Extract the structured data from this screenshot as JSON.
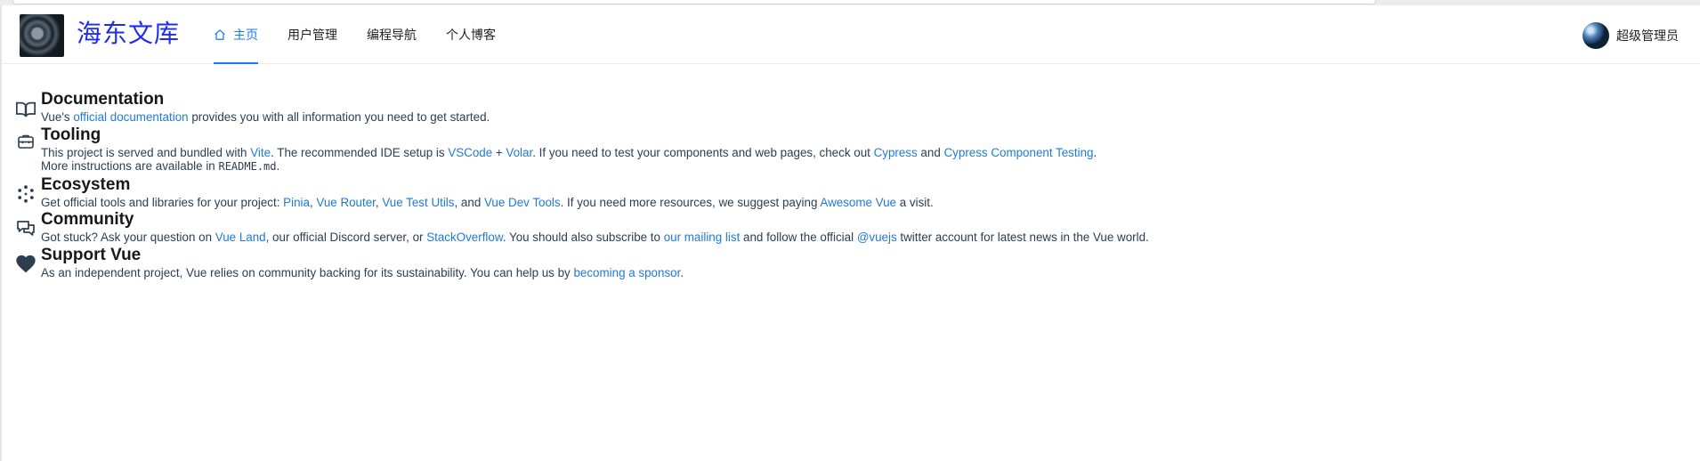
{
  "header": {
    "site_title": "海东文库",
    "nav": [
      {
        "label": "主页",
        "icon": "home-icon",
        "active": true
      },
      {
        "label": "用户管理"
      },
      {
        "label": "编程导航"
      },
      {
        "label": "个人博客"
      }
    ],
    "user_name": "超级管理员"
  },
  "sections": {
    "documentation": {
      "title": "Documentation",
      "icon": "book-icon",
      "t1": "Vue's ",
      "l1": "official documentation",
      "t2": " provides you with all information you need to get started."
    },
    "tooling": {
      "title": "Tooling",
      "icon": "toolbox-icon",
      "t1": "This project is served and bundled with ",
      "l_vite": "Vite",
      "t2": ". The recommended IDE setup is ",
      "l_vscode": "VSCode",
      "t3": " + ",
      "l_volar": "Volar",
      "t4": ". If you need to test your components and web pages, check out ",
      "l_cypress": "Cypress",
      "t5": " and ",
      "l_cypress_ct": "Cypress Component Testing",
      "t6": ".",
      "t7": "More instructions are available in ",
      "code": "README.md",
      "t8": "."
    },
    "ecosystem": {
      "title": "Ecosystem",
      "icon": "ecosystem-icon",
      "t1": "Get official tools and libraries for your project: ",
      "l_pinia": "Pinia",
      "t2": ", ",
      "l_router": "Vue Router",
      "t3": ", ",
      "l_test_utils": "Vue Test Utils",
      "t4": ", and ",
      "l_devtools": "Vue Dev Tools",
      "t5": ". If you need more resources, we suggest paying ",
      "l_awesome": "Awesome Vue",
      "t6": " a visit."
    },
    "community": {
      "title": "Community",
      "icon": "chat-bubbles-icon",
      "t1": "Got stuck? Ask your question on ",
      "l_vueland": "Vue Land",
      "t2": ", our official Discord server, or ",
      "l_stackoverflow": "StackOverflow",
      "t3": ". You should also subscribe to ",
      "l_mailing": "our mailing list",
      "t4": " and follow the official ",
      "l_vuejs": "@vuejs",
      "t5": " twitter account for latest news in the Vue world."
    },
    "support": {
      "title": "Support Vue",
      "icon": "heart-icon",
      "t1": "As an independent project, Vue relies on community backing for its sustainability. You can help us by ",
      "l_sponsor": "becoming a sponsor",
      "t2": "."
    }
  },
  "colors": {
    "brand_title": "#1d2cf0",
    "nav_active": "#1677ff",
    "link": "#1f7ad6"
  }
}
